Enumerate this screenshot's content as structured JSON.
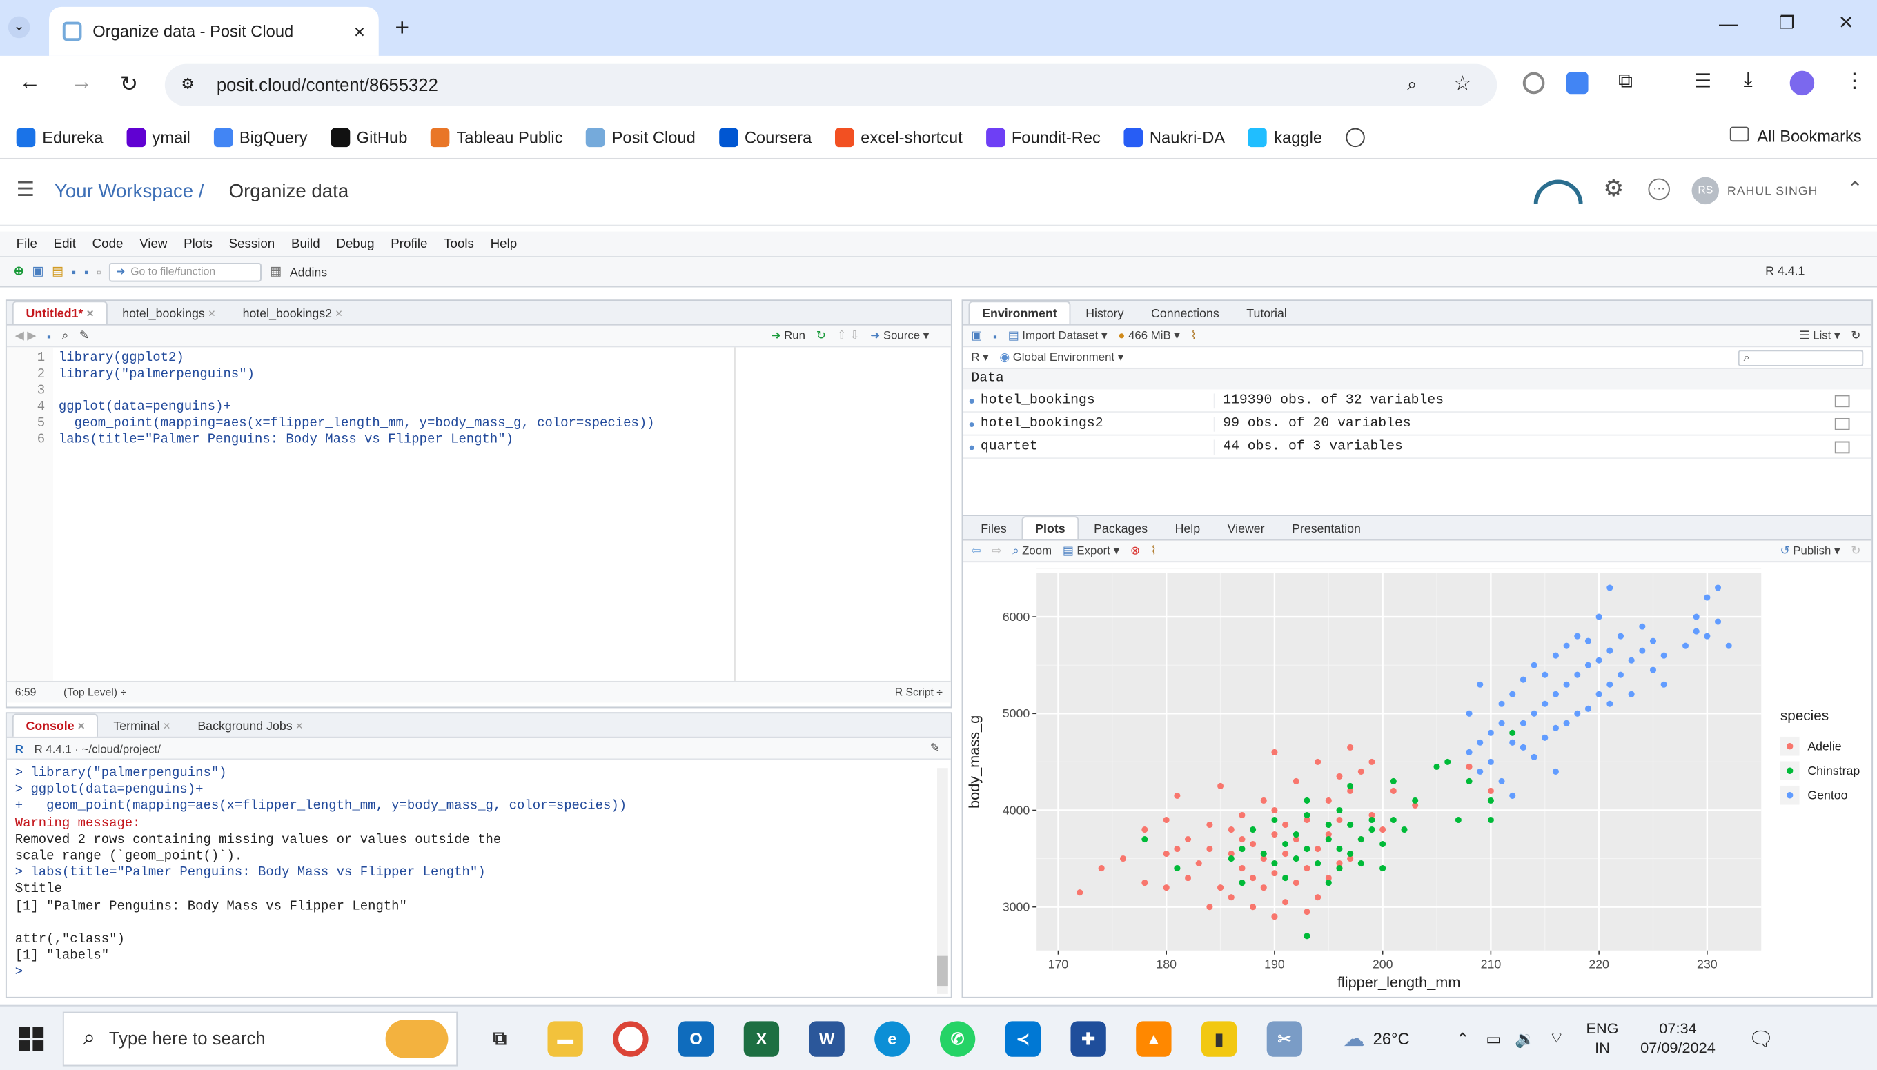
{
  "browser": {
    "tab_title": "Organize data - Posit Cloud",
    "url": "posit.cloud/content/8655322",
    "bookmarks": [
      {
        "label": "Edureka",
        "color": "#1a73e8"
      },
      {
        "label": "ymail",
        "color": "#6001d2"
      },
      {
        "label": "BigQuery",
        "color": "#4285f4"
      },
      {
        "label": "GitHub",
        "color": "#111111"
      },
      {
        "label": "Tableau Public",
        "color": "#e97627"
      },
      {
        "label": "Posit Cloud",
        "color": "#75aadb"
      },
      {
        "label": "Coursera",
        "color": "#0056d2"
      },
      {
        "label": "excel-shortcut",
        "color": "#f25022"
      },
      {
        "label": "Foundit-Rec",
        "color": "#6e3ff5"
      },
      {
        "label": "Naukri-DA",
        "color": "#275df5"
      },
      {
        "label": "kaggle",
        "color": "#20beff"
      }
    ],
    "all_bookmarks": "All Bookmarks"
  },
  "posit": {
    "workspace": "Your Workspace /",
    "project": "Organize data",
    "user": "RAHUL SINGH"
  },
  "rstudio": {
    "menu": [
      "File",
      "Edit",
      "Code",
      "View",
      "Plots",
      "Session",
      "Build",
      "Debug",
      "Profile",
      "Tools",
      "Help"
    ],
    "goto_placeholder": "Go to file/function",
    "addins": "Addins",
    "r_version": "R 4.4.1",
    "editor": {
      "tabs": [
        "Untitled1*",
        "hotel_bookings",
        "hotel_bookings2"
      ],
      "run": "Run",
      "source": "Source",
      "lines": [
        {
          "n": "1",
          "t": "library(ggplot2)"
        },
        {
          "n": "2",
          "t": "library(\"palmerpenguins\")"
        },
        {
          "n": "3",
          "t": ""
        },
        {
          "n": "4",
          "t": "ggplot(data=penguins)+"
        },
        {
          "n": "5",
          "t": "  geom_point(mapping=aes(x=flipper_length_mm, y=body_mass_g, color=species))"
        },
        {
          "n": "6",
          "t": "labs(title=\"Palmer Penguins: Body Mass vs Flipper Length\")"
        }
      ],
      "status_pos": "6:59",
      "status_level": "(Top Level) ÷",
      "status_type": "R Script ÷"
    },
    "console": {
      "tabs": [
        "Console",
        "Terminal",
        "Background Jobs"
      ],
      "path": "R 4.4.1 · ~/cloud/project/",
      "lines": [
        {
          "t": "> library(\"palmerpenguins\")",
          "k": "cmd"
        },
        {
          "t": "> ggplot(data=penguins)+",
          "k": "cmd"
        },
        {
          "t": "+   geom_point(mapping=aes(x=flipper_length_mm, y=body_mass_g, color=species))",
          "k": "cmd"
        },
        {
          "t": "Warning message:",
          "k": "warn"
        },
        {
          "t": "Removed 2 rows containing missing values or values outside the",
          "k": "out"
        },
        {
          "t": "scale range (`geom_point()`).",
          "k": "out"
        },
        {
          "t": "> labs(title=\"Palmer Penguins: Body Mass vs Flipper Length\")",
          "k": "cmd"
        },
        {
          "t": "$title",
          "k": "out"
        },
        {
          "t": "[1] \"Palmer Penguins: Body Mass vs Flipper Length\"",
          "k": "out"
        },
        {
          "t": "",
          "k": "out"
        },
        {
          "t": "attr(,\"class\")",
          "k": "out"
        },
        {
          "t": "[1] \"labels\"",
          "k": "out"
        },
        {
          "t": ">",
          "k": "cmd"
        }
      ]
    },
    "env": {
      "tabs": [
        "Environment",
        "History",
        "Connections",
        "Tutorial"
      ],
      "import": "Import Dataset",
      "memory": "466 MiB",
      "list": "List",
      "r_label": "R",
      "scope": "Global Environment",
      "section": "Data",
      "rows": [
        {
          "name": "hotel_bookings",
          "desc": "119390 obs. of 32 variables"
        },
        {
          "name": "hotel_bookings2",
          "desc": "99 obs. of 20 variables"
        },
        {
          "name": "quartet",
          "desc": "44 obs. of 3 variables"
        }
      ]
    },
    "files": {
      "tabs": [
        "Files",
        "Plots",
        "Packages",
        "Help",
        "Viewer",
        "Presentation"
      ],
      "zoom": "Zoom",
      "export": "Export",
      "publish": "Publish"
    }
  },
  "chart_data": {
    "type": "scatter",
    "xlabel": "flipper_length_mm",
    "ylabel": "body_mass_g",
    "xlim": [
      168,
      235
    ],
    "ylim": [
      2550,
      6450
    ],
    "xticks": [
      170,
      180,
      190,
      200,
      210,
      220,
      230
    ],
    "yticks": [
      3000,
      4000,
      5000,
      6000
    ],
    "legend_title": "species",
    "legend_position": "right",
    "series": [
      {
        "name": "Adelie",
        "color": "#f8766d",
        "points": [
          [
            172,
            3150
          ],
          [
            174,
            3400
          ],
          [
            176,
            3500
          ],
          [
            178,
            3250
          ],
          [
            178,
            3800
          ],
          [
            180,
            3200
          ],
          [
            180,
            3550
          ],
          [
            180,
            3900
          ],
          [
            181,
            3600
          ],
          [
            181,
            4150
          ],
          [
            182,
            3300
          ],
          [
            182,
            3700
          ],
          [
            183,
            3450
          ],
          [
            184,
            3000
          ],
          [
            184,
            3850
          ],
          [
            184,
            3600
          ],
          [
            185,
            3200
          ],
          [
            185,
            4250
          ],
          [
            186,
            3550
          ],
          [
            186,
            3800
          ],
          [
            186,
            3100
          ],
          [
            187,
            3400
          ],
          [
            187,
            3700
          ],
          [
            187,
            3950
          ],
          [
            188,
            3000
          ],
          [
            188,
            3300
          ],
          [
            188,
            3650
          ],
          [
            189,
            3500
          ],
          [
            189,
            4100
          ],
          [
            189,
            3200
          ],
          [
            190,
            2900
          ],
          [
            190,
            3350
          ],
          [
            190,
            3750
          ],
          [
            190,
            4000
          ],
          [
            190,
            4600
          ],
          [
            191,
            3050
          ],
          [
            191,
            3550
          ],
          [
            191,
            3850
          ],
          [
            192,
            3250
          ],
          [
            192,
            3700
          ],
          [
            192,
            4300
          ],
          [
            193,
            2950
          ],
          [
            193,
            3400
          ],
          [
            193,
            3900
          ],
          [
            194,
            3100
          ],
          [
            194,
            3600
          ],
          [
            194,
            4500
          ],
          [
            195,
            3300
          ],
          [
            195,
            3750
          ],
          [
            195,
            4100
          ],
          [
            196,
            3450
          ],
          [
            196,
            3900
          ],
          [
            196,
            4350
          ],
          [
            197,
            3500
          ],
          [
            197,
            4200
          ],
          [
            197,
            4650
          ],
          [
            198,
            3700
          ],
          [
            198,
            4400
          ],
          [
            199,
            3950
          ],
          [
            199,
            4500
          ],
          [
            200,
            3800
          ],
          [
            201,
            4200
          ],
          [
            203,
            4050
          ],
          [
            208,
            4450
          ],
          [
            210,
            4200
          ]
        ]
      },
      {
        "name": "Chinstrap",
        "color": "#00ba38",
        "points": [
          [
            178,
            3700
          ],
          [
            181,
            3400
          ],
          [
            187,
            3250
          ],
          [
            187,
            3600
          ],
          [
            188,
            3800
          ],
          [
            189,
            3550
          ],
          [
            190,
            3450
          ],
          [
            190,
            3900
          ],
          [
            191,
            3650
          ],
          [
            191,
            3300
          ],
          [
            192,
            3500
          ],
          [
            192,
            3750
          ],
          [
            193,
            3600
          ],
          [
            193,
            3950
          ],
          [
            193,
            4100
          ],
          [
            194,
            3450
          ],
          [
            195,
            3700
          ],
          [
            195,
            3850
          ],
          [
            195,
            3250
          ],
          [
            196,
            3600
          ],
          [
            196,
            4000
          ],
          [
            196,
            3400
          ],
          [
            197,
            3850
          ],
          [
            197,
            3550
          ],
          [
            197,
            4250
          ],
          [
            198,
            3700
          ],
          [
            198,
            3450
          ],
          [
            199,
            3800
          ],
          [
            199,
            3900
          ],
          [
            200,
            3650
          ],
          [
            200,
            3400
          ],
          [
            201,
            3900
          ],
          [
            201,
            4300
          ],
          [
            202,
            3800
          ],
          [
            203,
            4100
          ],
          [
            205,
            4450
          ],
          [
            206,
            4500
          ],
          [
            207,
            3900
          ],
          [
            208,
            4300
          ],
          [
            210,
            3900
          ],
          [
            210,
            4100
          ],
          [
            212,
            4800
          ],
          [
            193,
            2700
          ],
          [
            186,
            3500
          ]
        ]
      },
      {
        "name": "Gentoo",
        "color": "#619cff",
        "points": [
          [
            208,
            4600
          ],
          [
            208,
            5000
          ],
          [
            209,
            4400
          ],
          [
            209,
            4700
          ],
          [
            209,
            5300
          ],
          [
            210,
            4800
          ],
          [
            210,
            4500
          ],
          [
            211,
            4300
          ],
          [
            211,
            4900
          ],
          [
            211,
            5100
          ],
          [
            212,
            4700
          ],
          [
            212,
            5200
          ],
          [
            213,
            4650
          ],
          [
            213,
            4900
          ],
          [
            213,
            5350
          ],
          [
            214,
            4550
          ],
          [
            214,
            5000
          ],
          [
            214,
            5500
          ],
          [
            215,
            4750
          ],
          [
            215,
            5100
          ],
          [
            215,
            5400
          ],
          [
            216,
            4850
          ],
          [
            216,
            5200
          ],
          [
            216,
            5600
          ],
          [
            217,
            4900
          ],
          [
            217,
            5300
          ],
          [
            217,
            5700
          ],
          [
            218,
            5000
          ],
          [
            218,
            5400
          ],
          [
            218,
            5800
          ],
          [
            219,
            5050
          ],
          [
            219,
            5500
          ],
          [
            219,
            5750
          ],
          [
            220,
            5200
          ],
          [
            220,
            5550
          ],
          [
            220,
            6000
          ],
          [
            221,
            5300
          ],
          [
            221,
            5650
          ],
          [
            221,
            5100
          ],
          [
            222,
            5400
          ],
          [
            222,
            5800
          ],
          [
            223,
            5550
          ],
          [
            223,
            5200
          ],
          [
            224,
            5650
          ],
          [
            224,
            5900
          ],
          [
            225,
            5450
          ],
          [
            225,
            5750
          ],
          [
            226,
            5300
          ],
          [
            226,
            5600
          ],
          [
            228,
            5700
          ],
          [
            229,
            6000
          ],
          [
            229,
            5850
          ],
          [
            230,
            5800
          ],
          [
            230,
            6200
          ],
          [
            231,
            5950
          ],
          [
            231,
            6300
          ],
          [
            232,
            5700
          ],
          [
            221,
            6300
          ],
          [
            216,
            4400
          ],
          [
            212,
            4150
          ]
        ]
      }
    ]
  },
  "taskbar": {
    "search": "Type here to search",
    "weather": "26°C",
    "lang1": "ENG",
    "lang2": "IN",
    "time": "07:34",
    "date": "07/09/2024"
  }
}
